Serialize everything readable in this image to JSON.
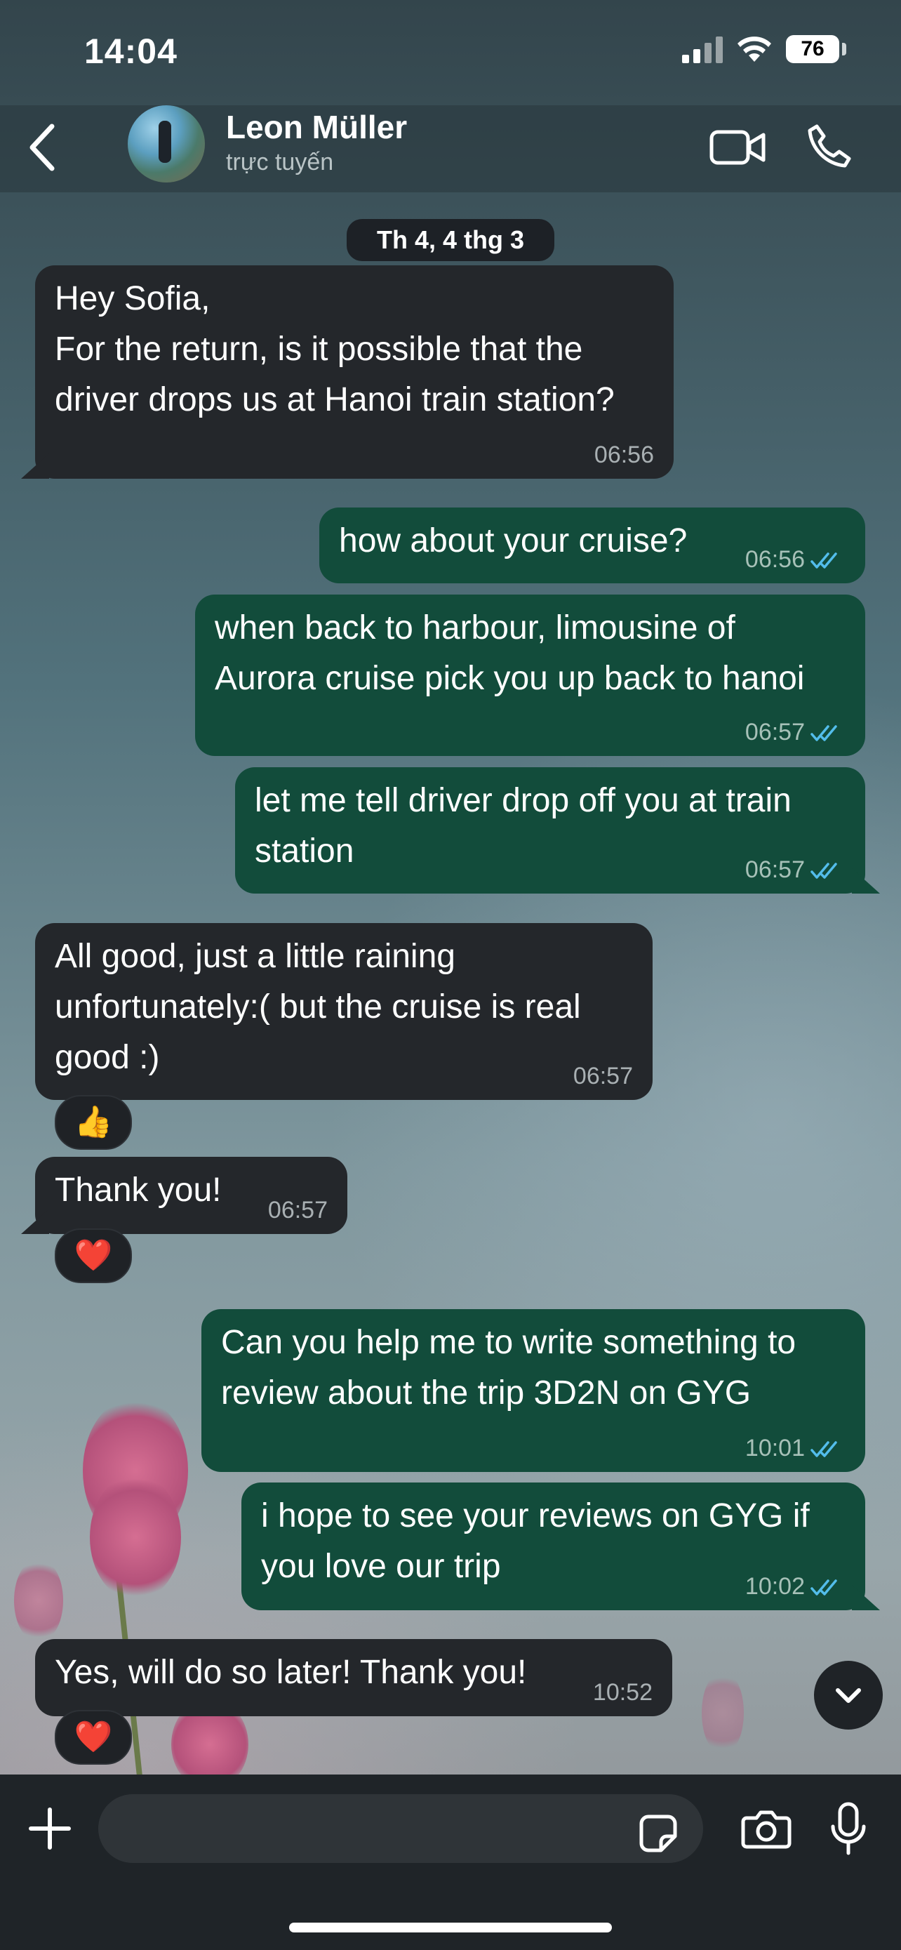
{
  "status_bar": {
    "time": "14:04",
    "battery": "76"
  },
  "header": {
    "contact_name": "Leon Müller",
    "contact_status": "trực tuyến"
  },
  "chat": {
    "date_separator": "Th 4, 4 thg 3",
    "messages": [
      {
        "direction": "incoming",
        "lines": [
          "Hey Sofia,",
          "For the return, is it possible that the",
          "driver drops us at Hanoi train station?"
        ],
        "time": "06:56"
      },
      {
        "direction": "outgoing",
        "lines": [
          "how about your cruise?"
        ],
        "time": "06:56",
        "status": "read"
      },
      {
        "direction": "outgoing",
        "lines": [
          "when back to harbour, limousine of",
          "Aurora cruise pick you up back to hanoi"
        ],
        "time": "06:57",
        "status": "read"
      },
      {
        "direction": "outgoing",
        "lines": [
          "let me tell driver drop off you at train",
          "station"
        ],
        "time": "06:57",
        "status": "read"
      },
      {
        "direction": "incoming",
        "lines": [
          "All good, just a little raining",
          "unfortunately:( but the cruise is real",
          "good :)"
        ],
        "time": "06:57",
        "reaction": "👍"
      },
      {
        "direction": "incoming",
        "lines": [
          "Thank you!"
        ],
        "time": "06:57",
        "reaction": "❤️"
      },
      {
        "direction": "outgoing",
        "lines": [
          "Can you help me to write something to",
          "review about the trip 3D2N on GYG"
        ],
        "time": "10:01",
        "status": "read"
      },
      {
        "direction": "outgoing",
        "lines": [
          "i hope to see your reviews on GYG if",
          "you love our trip"
        ],
        "time": "10:02",
        "status": "read"
      },
      {
        "direction": "incoming",
        "lines": [
          "Yes, will do so later! Thank you!"
        ],
        "time": "10:52",
        "reaction": "❤️"
      }
    ]
  },
  "input": {
    "value": "",
    "placeholder": ""
  },
  "icons": {
    "back": "chevron-left-icon",
    "video": "video-camera-icon",
    "call": "phone-icon",
    "plus": "plus-icon",
    "sticker": "sticker-icon",
    "camera": "camera-icon",
    "mic": "microphone-icon",
    "scroll": "chevron-down-icon",
    "read_receipt": "double-check-icon"
  },
  "colors": {
    "incoming_bubble": "#24272b",
    "outgoing_bubble": "#124c3b",
    "read_ticks": "#53bdeb"
  }
}
